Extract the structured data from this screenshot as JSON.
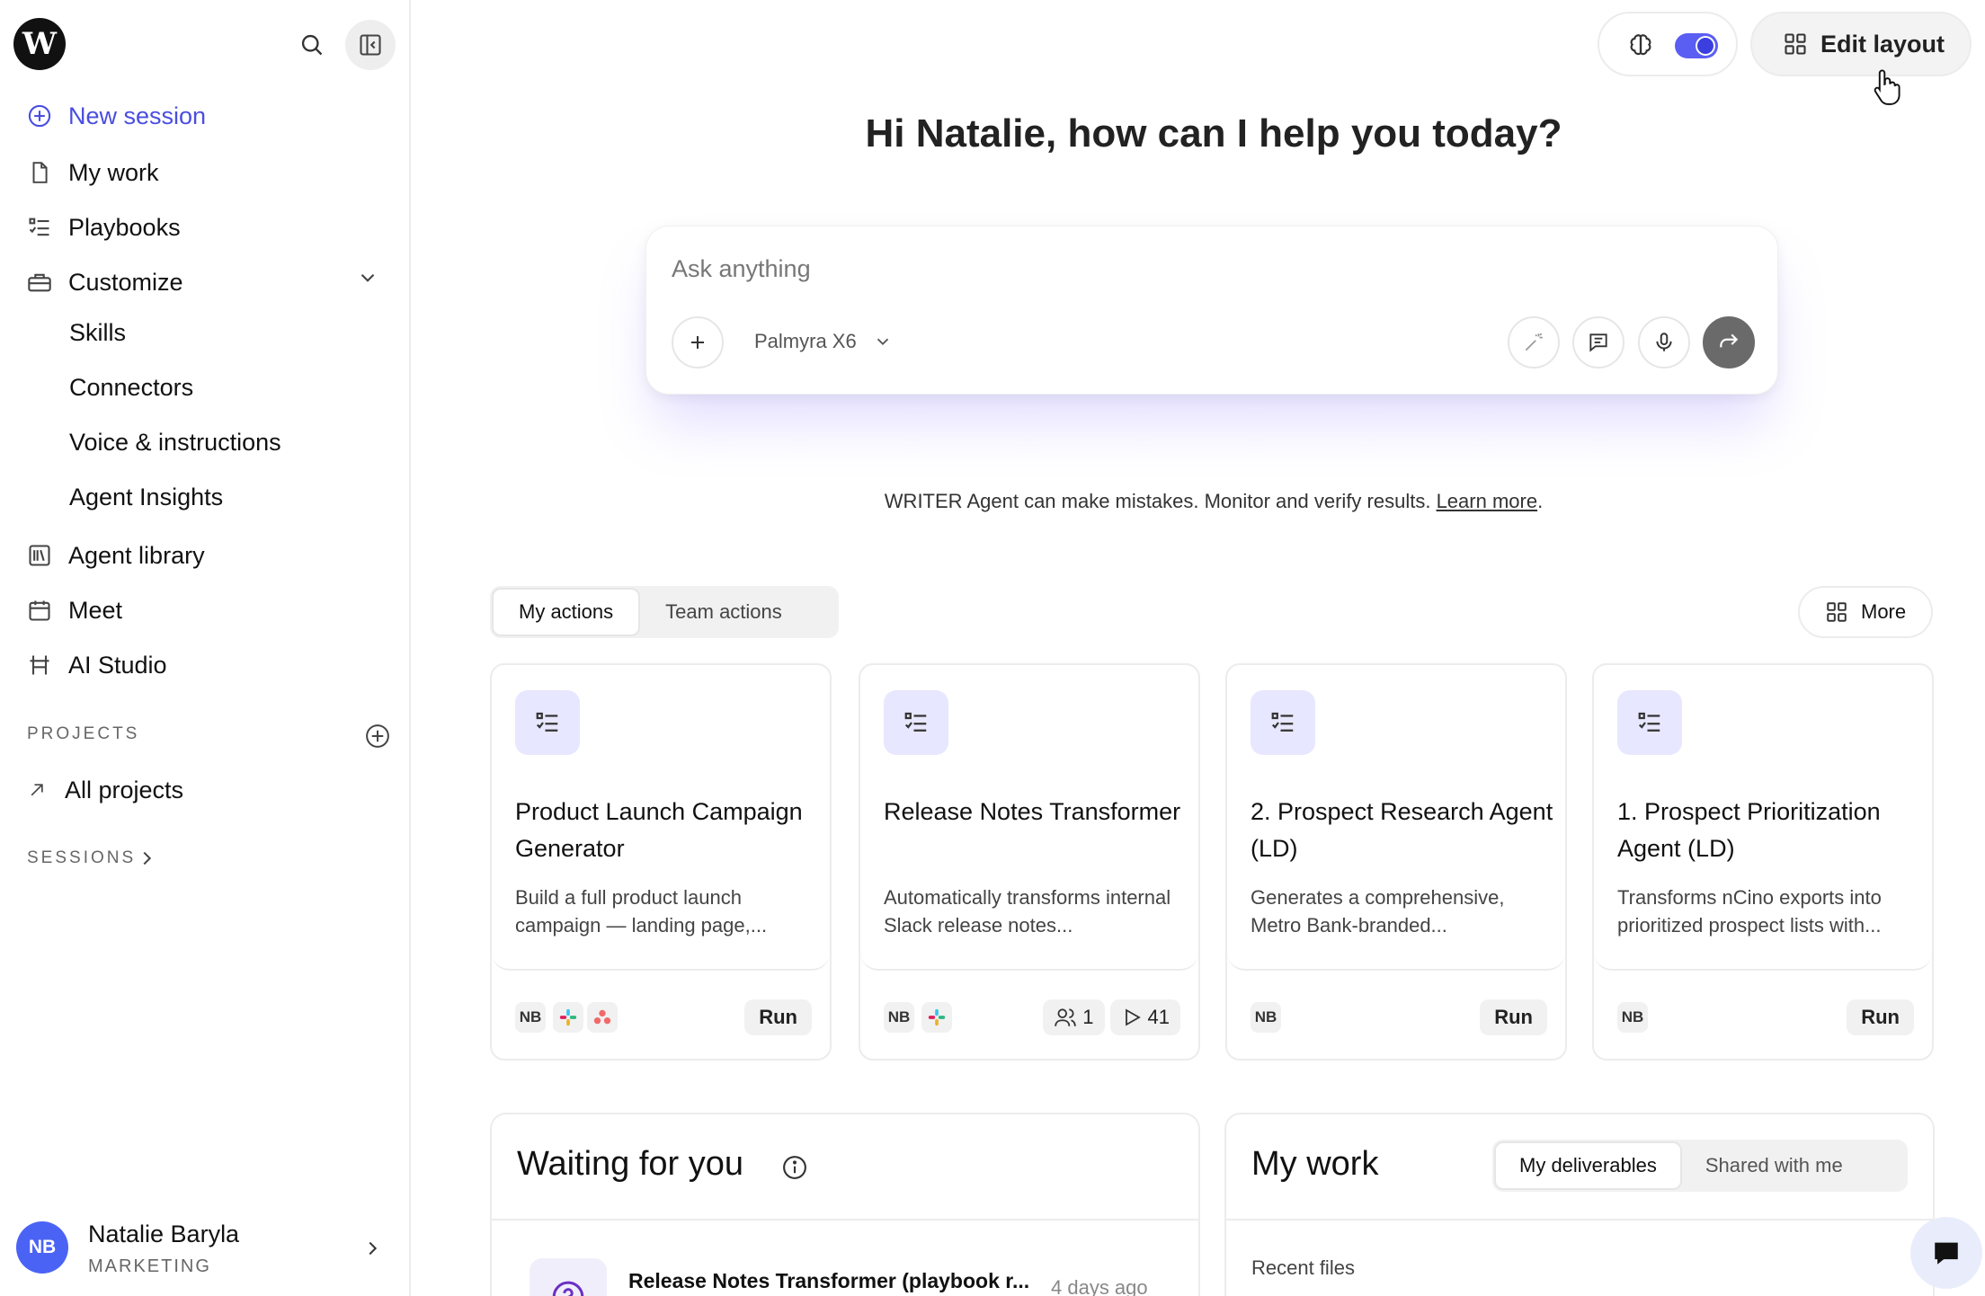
{
  "sidebar": {
    "logo": "W",
    "items": {
      "new_session": "New session",
      "my_work": "My work",
      "playbooks": "Playbooks",
      "customize": "Customize",
      "skills": "Skills",
      "connectors": "Connectors",
      "voice": "Voice & instructions",
      "insights": "Agent Insights",
      "agent_library": "Agent library",
      "meet": "Meet",
      "ai_studio": "AI Studio"
    },
    "projects_label": "PROJECTS",
    "all_projects": "All projects",
    "sessions_label": "SESSIONS",
    "user": {
      "initials": "NB",
      "name": "Natalie Baryla",
      "dept": "MARKETING"
    }
  },
  "topbar": {
    "edit_layout": "Edit layout",
    "toggle_on": true
  },
  "greeting": "Hi Natalie, how can I help you today?",
  "composer": {
    "placeholder": "Ask anything",
    "model": "Palmyra X6"
  },
  "disclaimer": {
    "text": "WRITER Agent can make mistakes. Monitor and verify results. ",
    "link": "Learn more",
    "end": "."
  },
  "actions": {
    "tabs": [
      "My actions",
      "Team actions"
    ],
    "active_tab": "My actions",
    "more": "More",
    "cards": [
      {
        "title": "Product Launch Campaign Generator",
        "desc": "Build a full product launch campaign — landing page,...",
        "owner": "NB",
        "run": "Run"
      },
      {
        "title": "Release Notes Transformer",
        "desc": "Automatically transforms internal Slack release notes...",
        "owner": "NB",
        "users": "1",
        "runs": "41"
      },
      {
        "title": "2. Prospect Research Agent (LD)",
        "desc": "Generates a comprehensive, Metro Bank-branded...",
        "owner": "NB",
        "run": "Run"
      },
      {
        "title": "1. Prospect Prioritization Agent (LD)",
        "desc": "Transforms nCino exports into prioritized prospect lists with...",
        "owner": "NB",
        "run": "Run"
      }
    ]
  },
  "waiting": {
    "title": "Waiting for you",
    "row_title": "Release Notes Transformer (playbook r...",
    "row_time": "4 days ago"
  },
  "mywork": {
    "title": "My work",
    "tabs": [
      "My deliverables",
      "Shared with me"
    ],
    "recent": "Recent files"
  },
  "colors": {
    "accent": "#4a4de0",
    "badge_bg": "#e7e7ff",
    "avatar": "#4b63f5"
  }
}
